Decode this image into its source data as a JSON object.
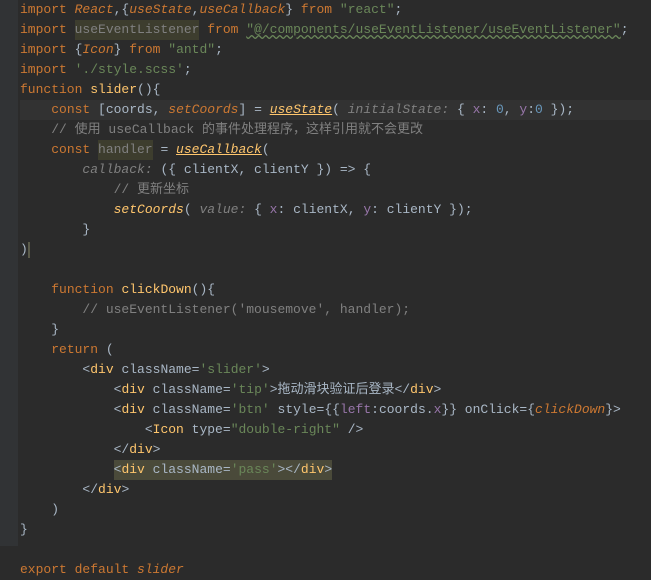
{
  "lines": [
    {
      "indent": 0,
      "tokens": [
        {
          "t": "import ",
          "c": "kw"
        },
        {
          "t": "React",
          "c": "kw-i"
        },
        {
          "t": ",{",
          "c": "ident"
        },
        {
          "t": "useState",
          "c": "kw-i"
        },
        {
          "t": ",",
          "c": "ident"
        },
        {
          "t": "useCallback",
          "c": "kw-i"
        },
        {
          "t": "} ",
          "c": "ident"
        },
        {
          "t": "from ",
          "c": "kw"
        },
        {
          "t": "\"react\"",
          "c": "str"
        },
        {
          "t": ";",
          "c": "ident"
        }
      ]
    },
    {
      "indent": 0,
      "tokens": [
        {
          "t": "import ",
          "c": "kw"
        },
        {
          "t": "useEventListener",
          "c": "unused"
        },
        {
          "t": " ",
          "c": "ident"
        },
        {
          "t": "from ",
          "c": "kw"
        },
        {
          "t": "\"@/components/useEventListener/useEventListener\"",
          "c": "str-u"
        },
        {
          "t": ";",
          "c": "ident"
        }
      ]
    },
    {
      "indent": 0,
      "tokens": [
        {
          "t": "import ",
          "c": "kw"
        },
        {
          "t": "{",
          "c": "ident"
        },
        {
          "t": "Icon",
          "c": "kw-i"
        },
        {
          "t": "} ",
          "c": "ident"
        },
        {
          "t": "from ",
          "c": "kw"
        },
        {
          "t": "\"antd\"",
          "c": "str"
        },
        {
          "t": ";",
          "c": "ident"
        }
      ]
    },
    {
      "indent": 0,
      "tokens": [
        {
          "t": "import ",
          "c": "kw"
        },
        {
          "t": "'./style.scss'",
          "c": "str"
        },
        {
          "t": ";",
          "c": "ident"
        }
      ]
    },
    {
      "indent": 0,
      "tokens": [
        {
          "t": "function ",
          "c": "kw"
        },
        {
          "t": "slider",
          "c": "def"
        },
        {
          "t": "(){",
          "c": "ident"
        }
      ]
    },
    {
      "indent": 1,
      "hl": true,
      "tokens": [
        {
          "t": "const ",
          "c": "kw"
        },
        {
          "t": "[",
          "c": "ident"
        },
        {
          "t": "coords",
          "c": "ident"
        },
        {
          "t": ", ",
          "c": "ident"
        },
        {
          "t": "setCoords",
          "c": "kw-i"
        },
        {
          "t": "] = ",
          "c": "ident"
        },
        {
          "t": "useState",
          "c": "fn hl-fn"
        },
        {
          "t": "( ",
          "c": "ident"
        },
        {
          "t": "initialState:",
          "c": "param"
        },
        {
          "t": " { ",
          "c": "ident"
        },
        {
          "t": "x",
          "c": "prop"
        },
        {
          "t": ": ",
          "c": "ident"
        },
        {
          "t": "0",
          "c": "num"
        },
        {
          "t": ", ",
          "c": "ident"
        },
        {
          "t": "y",
          "c": "prop"
        },
        {
          "t": ":",
          "c": "ident"
        },
        {
          "t": "0",
          "c": "num"
        },
        {
          "t": " });",
          "c": "ident"
        }
      ]
    },
    {
      "indent": 1,
      "tokens": [
        {
          "t": "// 使用 useCallback 的事件处理程序，这样引用就不会更改",
          "c": "com"
        }
      ]
    },
    {
      "indent": 1,
      "tokens": [
        {
          "t": "const ",
          "c": "kw"
        },
        {
          "t": "handler",
          "c": "unused"
        },
        {
          "t": " = ",
          "c": "ident"
        },
        {
          "t": "useCallback",
          "c": "fn hl-fn"
        },
        {
          "t": "(",
          "c": "ident"
        }
      ]
    },
    {
      "indent": 2,
      "tokens": [
        {
          "t": "callback:",
          "c": "param"
        },
        {
          "t": " ({ clientX, clientY }) => {",
          "c": "ident"
        }
      ]
    },
    {
      "indent": 3,
      "tokens": [
        {
          "t": "// 更新坐标",
          "c": "com"
        }
      ]
    },
    {
      "indent": 3,
      "tokens": [
        {
          "t": "setCoords",
          "c": "fn"
        },
        {
          "t": "( ",
          "c": "ident"
        },
        {
          "t": "value:",
          "c": "param"
        },
        {
          "t": " { ",
          "c": "ident"
        },
        {
          "t": "x",
          "c": "prop"
        },
        {
          "t": ": clientX, ",
          "c": "ident"
        },
        {
          "t": "y",
          "c": "prop"
        },
        {
          "t": ": clientY });",
          "c": "ident"
        }
      ]
    },
    {
      "indent": 2,
      "tokens": [
        {
          "t": "}",
          "c": "ident"
        }
      ]
    },
    {
      "indent": 0,
      "tokens": [
        {
          "t": ")",
          "c": "ident"
        },
        {
          "t": "",
          "c": "caret",
          "caret": true
        }
      ]
    },
    {
      "indent": 0,
      "tokens": []
    },
    {
      "indent": 1,
      "tokens": [
        {
          "t": "function ",
          "c": "kw"
        },
        {
          "t": "clickDown",
          "c": "def"
        },
        {
          "t": "(){",
          "c": "ident"
        }
      ]
    },
    {
      "indent": 2,
      "tokens": [
        {
          "t": "// useEventListener('mousemove', handler);",
          "c": "com"
        }
      ]
    },
    {
      "indent": 1,
      "tokens": [
        {
          "t": "}",
          "c": "ident"
        }
      ]
    },
    {
      "indent": 1,
      "tokens": [
        {
          "t": "return ",
          "c": "kw"
        },
        {
          "t": "(",
          "c": "ident"
        }
      ]
    },
    {
      "indent": 2,
      "tokens": [
        {
          "t": "<",
          "c": "ident"
        },
        {
          "t": "div ",
          "c": "def"
        },
        {
          "t": "className",
          "c": "ident"
        },
        {
          "t": "=",
          "c": "ident"
        },
        {
          "t": "'slider'",
          "c": "str"
        },
        {
          "t": ">",
          "c": "ident"
        }
      ]
    },
    {
      "indent": 3,
      "tokens": [
        {
          "t": "<",
          "c": "ident"
        },
        {
          "t": "div ",
          "c": "def"
        },
        {
          "t": "className",
          "c": "ident"
        },
        {
          "t": "=",
          "c": "ident"
        },
        {
          "t": "'tip'",
          "c": "str"
        },
        {
          "t": ">拖动滑块验证后登录</",
          "c": "ident"
        },
        {
          "t": "div",
          "c": "def"
        },
        {
          "t": ">",
          "c": "ident"
        }
      ]
    },
    {
      "indent": 3,
      "tokens": [
        {
          "t": "<",
          "c": "ident"
        },
        {
          "t": "div ",
          "c": "def"
        },
        {
          "t": "className",
          "c": "ident"
        },
        {
          "t": "=",
          "c": "ident"
        },
        {
          "t": "'btn'",
          "c": "str"
        },
        {
          "t": " ",
          "c": "ident"
        },
        {
          "t": "style",
          "c": "ident"
        },
        {
          "t": "={{",
          "c": "ident"
        },
        {
          "t": "left",
          "c": "prop"
        },
        {
          "t": ":coords.",
          "c": "ident"
        },
        {
          "t": "x",
          "c": "prop"
        },
        {
          "t": "}} ",
          "c": "ident"
        },
        {
          "t": "onClick",
          "c": "ident"
        },
        {
          "t": "={",
          "c": "ident"
        },
        {
          "t": "clickDown",
          "c": "kw-i"
        },
        {
          "t": "}>",
          "c": "ident"
        }
      ]
    },
    {
      "indent": 4,
      "tokens": [
        {
          "t": "<",
          "c": "ident"
        },
        {
          "t": "Icon ",
          "c": "def"
        },
        {
          "t": "type",
          "c": "ident"
        },
        {
          "t": "=",
          "c": "ident"
        },
        {
          "t": "\"double-right\"",
          "c": "str"
        },
        {
          "t": " />",
          "c": "ident"
        }
      ]
    },
    {
      "indent": 3,
      "tokens": [
        {
          "t": "</",
          "c": "ident"
        },
        {
          "t": "div",
          "c": "def"
        },
        {
          "t": ">",
          "c": "ident"
        }
      ]
    },
    {
      "indent": 3,
      "tokens": [
        {
          "t": "<",
          "c": "ident sel"
        },
        {
          "t": "div ",
          "c": "def sel"
        },
        {
          "t": "className",
          "c": "ident sel"
        },
        {
          "t": "=",
          "c": "ident sel"
        },
        {
          "t": "'pass'",
          "c": "str sel"
        },
        {
          "t": "></",
          "c": "ident sel"
        },
        {
          "t": "div",
          "c": "def sel"
        },
        {
          "t": ">",
          "c": "ident sel"
        }
      ]
    },
    {
      "indent": 2,
      "tokens": [
        {
          "t": "</",
          "c": "ident"
        },
        {
          "t": "div",
          "c": "def"
        },
        {
          "t": ">",
          "c": "ident"
        }
      ]
    },
    {
      "indent": 1,
      "tokens": [
        {
          "t": ")",
          "c": "ident"
        }
      ]
    },
    {
      "indent": 0,
      "tokens": [
        {
          "t": "}",
          "c": "ident"
        }
      ]
    },
    {
      "indent": 0,
      "tokens": []
    },
    {
      "indent": 0,
      "tokens": [
        {
          "t": "export default ",
          "c": "kw"
        },
        {
          "t": "slider",
          "c": "kw-i"
        }
      ]
    }
  ]
}
